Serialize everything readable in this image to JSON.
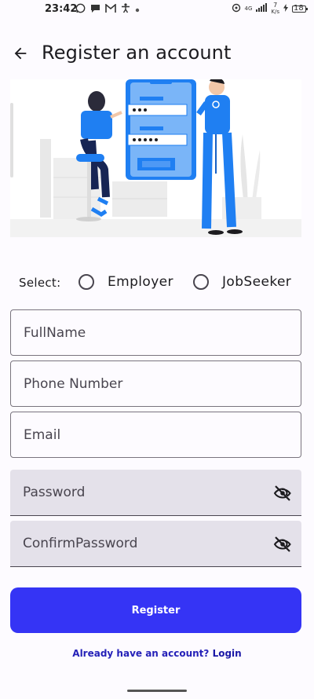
{
  "status_bar": {
    "time": "23:42",
    "network_rate_top": "7",
    "network_rate_unit": "K/s",
    "signal_label": "4G",
    "battery_level": "18"
  },
  "app_bar": {
    "title": "Register an account"
  },
  "role_selector": {
    "label": "Select:",
    "options": [
      "Employer",
      "JobSeeker"
    ],
    "selected": null
  },
  "form": {
    "fullname_placeholder": "FullName",
    "phone_placeholder": "Phone Number",
    "email_placeholder": "Email",
    "password_placeholder": "Password",
    "confirm_password_placeholder": "ConfirmPassword"
  },
  "actions": {
    "register_label": "Register",
    "login_prompt": "Already have an account?",
    "login_link": "Login"
  },
  "colors": {
    "accent": "#3534f5",
    "illustration_blue": "#1f7ff2",
    "filled_field_bg": "#e4e1ea"
  }
}
